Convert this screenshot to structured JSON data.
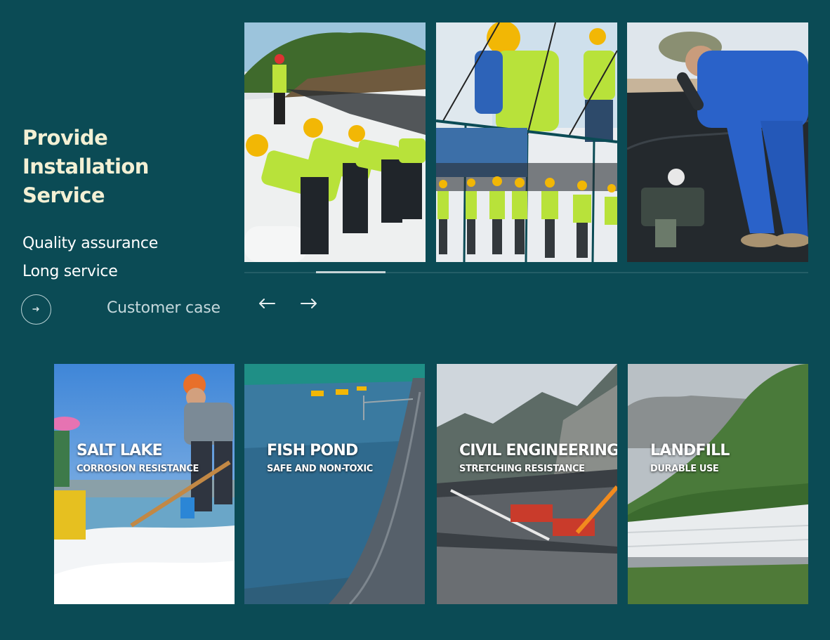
{
  "intro": {
    "title_line1": "Provide",
    "title_line2": "Installation Service",
    "points": [
      "Quality assurance",
      "Long service"
    ]
  },
  "nav": {
    "case_label": "Customer case",
    "prev_icon": "arrow-left-icon",
    "next_icon": "arrow-right-icon",
    "go_icon": "arrow-right-small-icon"
  },
  "slider": {
    "slides": [
      "installation-photo-rolling",
      "installation-photo-team",
      "installation-photo-welding"
    ]
  },
  "applications": [
    {
      "title": "SALT LAKE",
      "subtitle": "CORROSION RESISTANCE"
    },
    {
      "title": "FISH POND",
      "subtitle": "SAFE AND NON-TOXIC"
    },
    {
      "title": "CIVIL ENGINEERING",
      "subtitle": "STRETCHING RESISTANCE"
    },
    {
      "title": "LANDFILL",
      "subtitle": "DURABLE USE"
    }
  ],
  "colors": {
    "background": "#0b4b55",
    "title": "#f3f0d4",
    "vest": "#b8e23a",
    "helmet": "#f2b705",
    "liner": "#1d2226"
  }
}
